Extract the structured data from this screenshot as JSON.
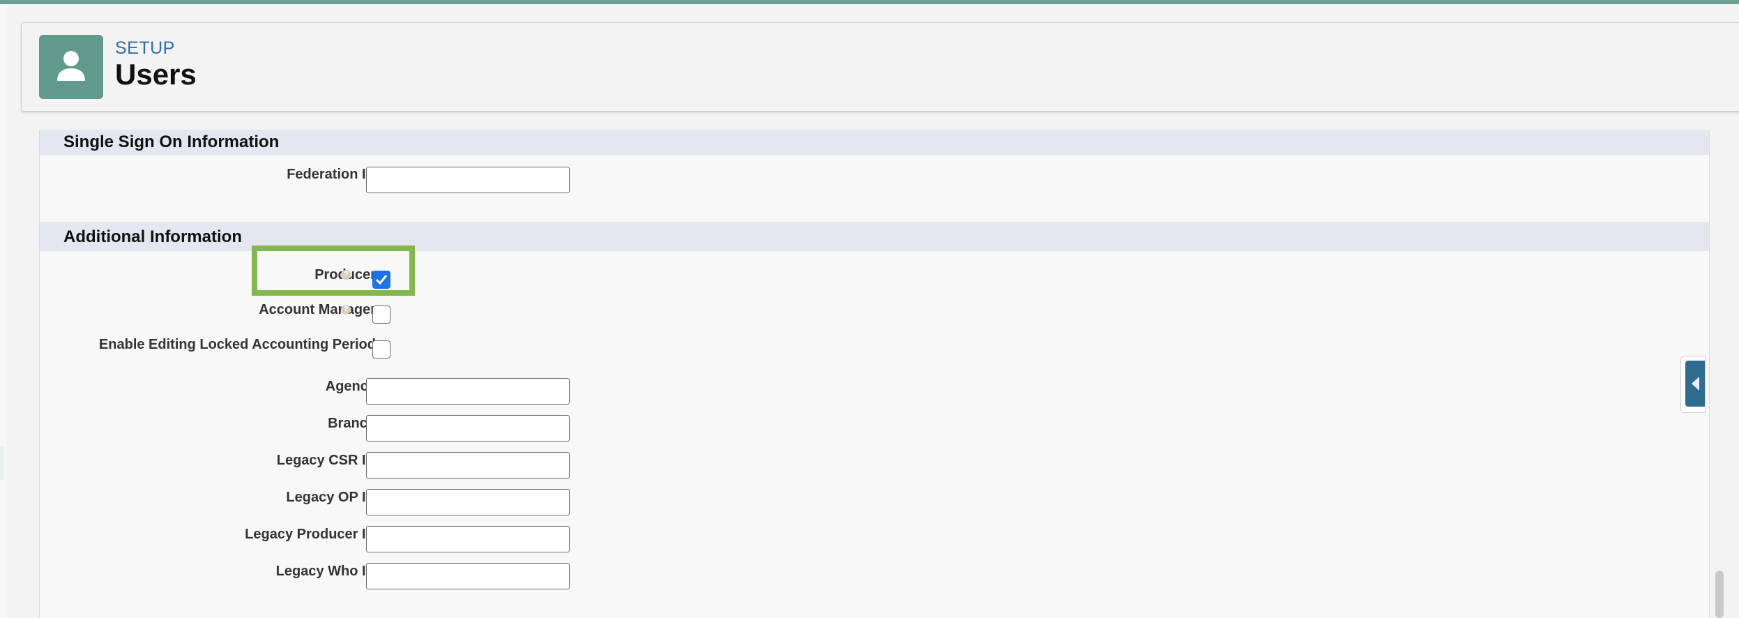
{
  "header": {
    "breadcrumb": "SETUP",
    "title": "Users",
    "icon": "user-icon"
  },
  "sections": {
    "sso": {
      "title": "Single Sign On Information",
      "federation_id_label": "Federation ID",
      "federation_id_value": ""
    },
    "additional": {
      "title": "Additional Information",
      "producer_label": "Producer",
      "producer_checked": true,
      "account_manager_label": "Account Manager",
      "account_manager_checked": false,
      "enable_editing_label": "Enable Editing Locked Accounting Period",
      "enable_editing_checked": false,
      "agency_label": "Agency",
      "agency_value": "",
      "branch_label": "Branch",
      "branch_value": "",
      "legacy_csr_label": "Legacy CSR ID",
      "legacy_csr_value": "",
      "legacy_op_label": "Legacy OP ID",
      "legacy_op_value": "",
      "legacy_producer_label": "Legacy Producer ID",
      "legacy_producer_value": "",
      "legacy_who_label": "Legacy Who ID",
      "legacy_who_value": ""
    }
  },
  "colors": {
    "accent": "#5f9a8d",
    "section_header": "#e5e7f0",
    "highlight": "#83b84d",
    "checkbox_checked": "#1a73e8",
    "link": "#2e6db3"
  }
}
